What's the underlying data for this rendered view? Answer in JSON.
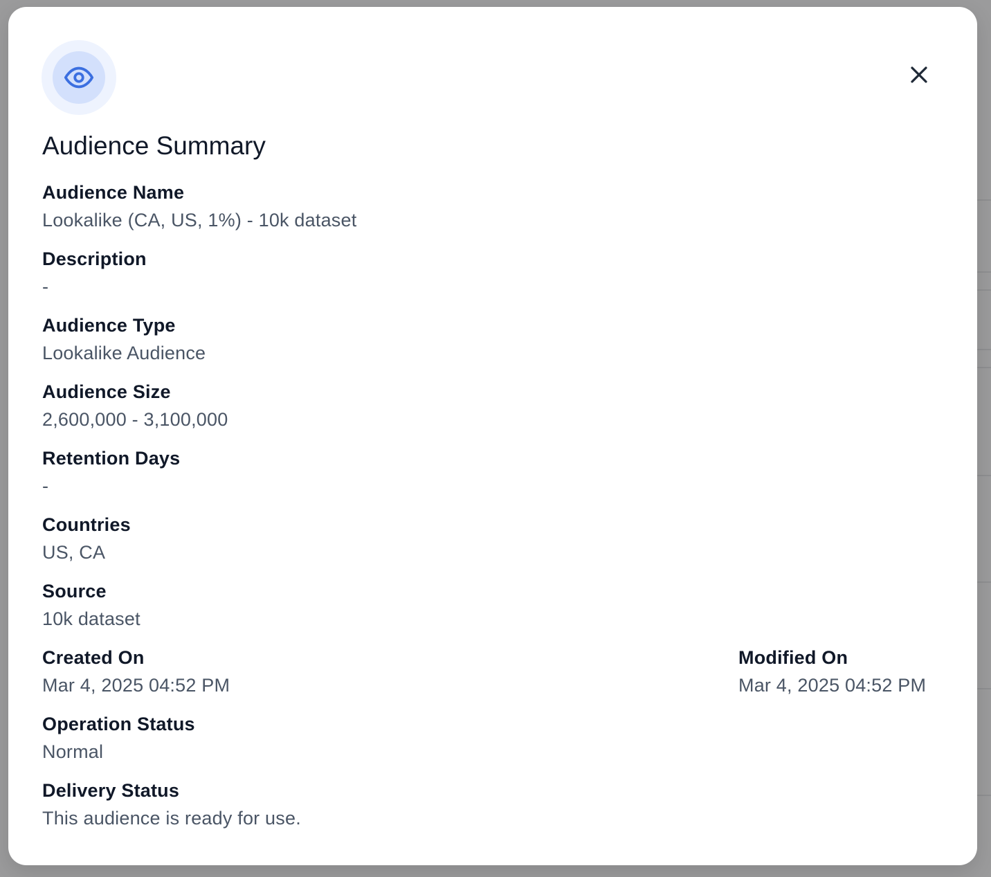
{
  "modal": {
    "title": "Audience Summary",
    "icon": "eye-icon",
    "close_icon": "close-icon",
    "accent_color": "#3b6fe0",
    "fields": {
      "audience_name": {
        "label": "Audience Name",
        "value": "Lookalike (CA, US, 1%) - 10k dataset"
      },
      "description": {
        "label": "Description",
        "value": "-"
      },
      "audience_type": {
        "label": "Audience Type",
        "value": "Lookalike Audience"
      },
      "audience_size": {
        "label": "Audience Size",
        "value": "2,600,000 - 3,100,000"
      },
      "retention_days": {
        "label": "Retention Days",
        "value": "-"
      },
      "countries": {
        "label": "Countries",
        "value": "US, CA"
      },
      "source": {
        "label": "Source",
        "value": "10k dataset"
      },
      "created_on": {
        "label": "Created On",
        "value": "Mar 4, 2025 04:52 PM"
      },
      "modified_on": {
        "label": "Modified On",
        "value": "Mar 4, 2025 04:52 PM"
      },
      "operation_status": {
        "label": "Operation Status",
        "value": "Normal"
      },
      "delivery_status": {
        "label": "Delivery Status",
        "value": "This audience is ready for use."
      }
    }
  }
}
